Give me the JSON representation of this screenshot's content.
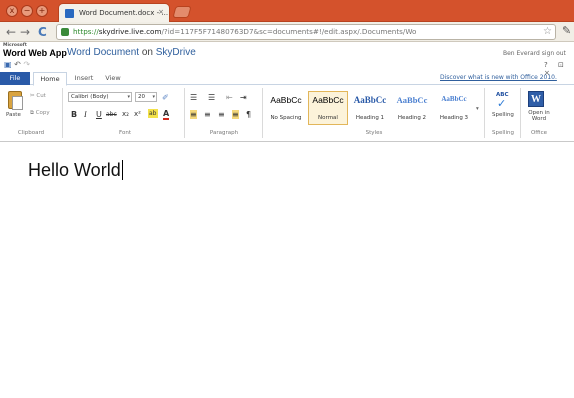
{
  "browser": {
    "tab_title": "Word Document.docx - ...",
    "url_scheme": "https://",
    "url_host": "skydrive.live.com",
    "url_rest": "/?id=117F5F71480763D7&sc=documents#!/edit.aspx/.Documents/Wo",
    "buttons": {
      "back": "←",
      "forward": "→",
      "reload": "C",
      "star": "☆",
      "wrench": "🔧"
    },
    "window_controls": [
      "x",
      "−",
      "+"
    ]
  },
  "header": {
    "brand_small": "Microsoft",
    "brand_app": "Word Web App",
    "doc_name": "Word Document",
    "on": "on",
    "service": "SkyDrive",
    "user": "Ben Everard  sign out",
    "help_controls": "? ⊡ ×"
  },
  "qat": {
    "save": "💾",
    "undo": "↶",
    "redo": "↷"
  },
  "ribbon_tabs": [
    "File",
    "Home",
    "Insert",
    "View"
  ],
  "discover_link": "Discover what is new with Office 2010.",
  "clipboard": {
    "paste": "Paste",
    "cut": "Cut",
    "copy": "Copy",
    "label": "Clipboard"
  },
  "font": {
    "family": "Calibri (Body)",
    "size": "20",
    "label": "Font",
    "buttons": [
      "B",
      "I",
      "U",
      "abc",
      "x₂",
      "x²",
      "ab",
      "A"
    ]
  },
  "paragraph": {
    "label": "Paragraph",
    "buttons": [
      "☰",
      "☰",
      "⇤",
      "⇥",
      "≡",
      "≡",
      "≡",
      "≡",
      "¶"
    ]
  },
  "styles": {
    "label": "Styles",
    "items": [
      {
        "sample": "AaBbCc",
        "name": "No Spacing"
      },
      {
        "sample": "AaBbCc",
        "name": "Normal"
      },
      {
        "sample": "AaBbCc",
        "name": "Heading 1"
      },
      {
        "sample": "AaBbCc",
        "name": "Heading 2"
      },
      {
        "sample": "AaBbCc",
        "name": "Heading 3"
      }
    ]
  },
  "spelling": {
    "abc": "ABC",
    "label": "Spelling",
    "group": "Spelling"
  },
  "office": {
    "open_in_word": "Open in Word",
    "group": "Office",
    "glyph": "W"
  },
  "document": {
    "body": "Hello World"
  },
  "colors": {
    "chrome": "#d4522c",
    "file_tab": "#2a5aa8",
    "link": "#2f5f9d",
    "highlight": "#f3e24a",
    "font_color": "#d12b1e"
  }
}
